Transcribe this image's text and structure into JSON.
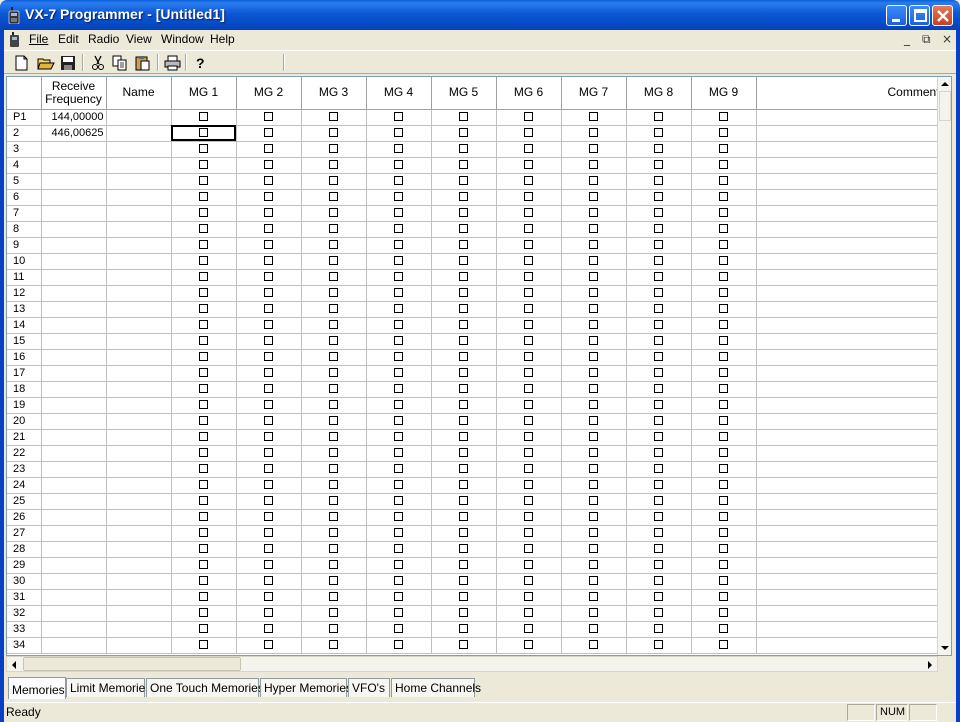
{
  "window": {
    "title": "VX-7 Programmer - [Untitled1]"
  },
  "menu": {
    "items": [
      {
        "label": "File"
      },
      {
        "label": "Edit"
      },
      {
        "label": "Radio"
      },
      {
        "label": "View"
      },
      {
        "label": "Window"
      },
      {
        "label": "Help"
      }
    ],
    "mdi_controls": [
      "_",
      "⧉",
      "×"
    ]
  },
  "toolbar": {
    "buttons": [
      "new-icon",
      "open-icon",
      "save-icon",
      "cut-icon",
      "copy-icon",
      "paste-icon",
      "print-icon",
      "help-icon"
    ]
  },
  "grid": {
    "columns": [
      "Receive Frequency",
      "Name",
      "MG 1",
      "MG 2",
      "MG 3",
      "MG 4",
      "MG 5",
      "MG 6",
      "MG 7",
      "MG 8",
      "MG 9",
      "Comment"
    ],
    "column_header_lines": {
      "receive_frequency": [
        "Receive",
        "Frequency"
      ]
    },
    "rows": [
      {
        "label": "P1",
        "frequency": "144,00000"
      },
      {
        "label": "2",
        "frequency": "446,00625"
      },
      {
        "label": "3",
        "frequency": ""
      },
      {
        "label": "4",
        "frequency": ""
      },
      {
        "label": "5",
        "frequency": ""
      },
      {
        "label": "6",
        "frequency": ""
      },
      {
        "label": "7",
        "frequency": ""
      },
      {
        "label": "8",
        "frequency": ""
      },
      {
        "label": "9",
        "frequency": ""
      },
      {
        "label": "10",
        "frequency": ""
      },
      {
        "label": "11",
        "frequency": ""
      },
      {
        "label": "12",
        "frequency": ""
      },
      {
        "label": "13",
        "frequency": ""
      },
      {
        "label": "14",
        "frequency": ""
      },
      {
        "label": "15",
        "frequency": ""
      },
      {
        "label": "16",
        "frequency": ""
      },
      {
        "label": "17",
        "frequency": ""
      },
      {
        "label": "18",
        "frequency": ""
      },
      {
        "label": "19",
        "frequency": ""
      },
      {
        "label": "20",
        "frequency": ""
      },
      {
        "label": "21",
        "frequency": ""
      },
      {
        "label": "22",
        "frequency": ""
      },
      {
        "label": "23",
        "frequency": ""
      },
      {
        "label": "24",
        "frequency": ""
      },
      {
        "label": "25",
        "frequency": ""
      },
      {
        "label": "26",
        "frequency": ""
      },
      {
        "label": "27",
        "frequency": ""
      },
      {
        "label": "28",
        "frequency": ""
      },
      {
        "label": "29",
        "frequency": ""
      },
      {
        "label": "30",
        "frequency": ""
      },
      {
        "label": "31",
        "frequency": ""
      },
      {
        "label": "32",
        "frequency": ""
      },
      {
        "label": "33",
        "frequency": ""
      },
      {
        "label": "34",
        "frequency": ""
      }
    ],
    "selected_cell": {
      "row": "2",
      "column": "MG 1"
    }
  },
  "tabs": [
    {
      "label": "Memories",
      "active": true
    },
    {
      "label": "Limit Memories",
      "active": false
    },
    {
      "label": "One Touch Memories",
      "active": false
    },
    {
      "label": "Hyper Memories",
      "active": false
    },
    {
      "label": "VFO's",
      "active": false
    },
    {
      "label": "Home Channels",
      "active": false
    }
  ],
  "status": {
    "text": "Ready",
    "num": "NUM"
  },
  "colors": {
    "titlebar": "#0a5fd8",
    "close_button": "#c8401f",
    "face": "#ece9d8"
  }
}
